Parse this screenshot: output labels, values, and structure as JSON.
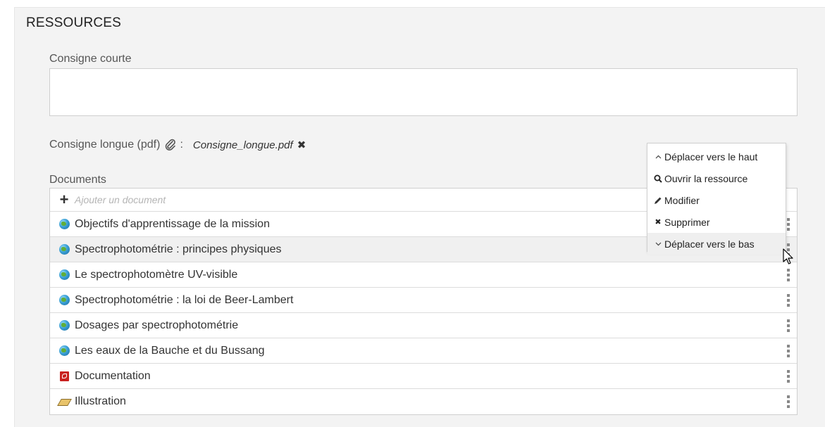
{
  "section": {
    "title": "RESSOURCES"
  },
  "short_instruction": {
    "label": "Consigne courte",
    "value": ""
  },
  "long_instruction": {
    "label": "Consigne longue (pdf)",
    "colon": ":",
    "filename": "Consigne_longue.pdf",
    "remove_icon": "close-icon"
  },
  "documents": {
    "label": "Documents",
    "add_placeholder": "Ajouter un document",
    "items": [
      {
        "title": "Objectifs d'apprentissage de la mission",
        "icon": "globe-icon"
      },
      {
        "title": "Spectrophotométrie : principes physiques",
        "icon": "globe-icon"
      },
      {
        "title": "Le spectrophotomètre UV-visible",
        "icon": "globe-icon"
      },
      {
        "title": "Spectrophotométrie : la loi de Beer-Lambert",
        "icon": "globe-icon"
      },
      {
        "title": "Dosages par spectrophotométrie",
        "icon": "globe-icon"
      },
      {
        "title": "Les eaux de la Bauche et du Bussang",
        "icon": "globe-icon"
      },
      {
        "title": "Documentation",
        "icon": "pdf-icon"
      },
      {
        "title": "Illustration",
        "icon": "image-icon"
      }
    ]
  },
  "context_menu": {
    "items": [
      {
        "label": "Déplacer vers le haut",
        "icon": "chevron-up-icon"
      },
      {
        "label": "Ouvrir la ressource",
        "icon": "search-icon"
      },
      {
        "label": "Modifier",
        "icon": "pencil-icon"
      },
      {
        "label": "Supprimer",
        "icon": "close-icon"
      },
      {
        "label": "Déplacer vers le bas",
        "icon": "chevron-down-icon"
      }
    ]
  }
}
